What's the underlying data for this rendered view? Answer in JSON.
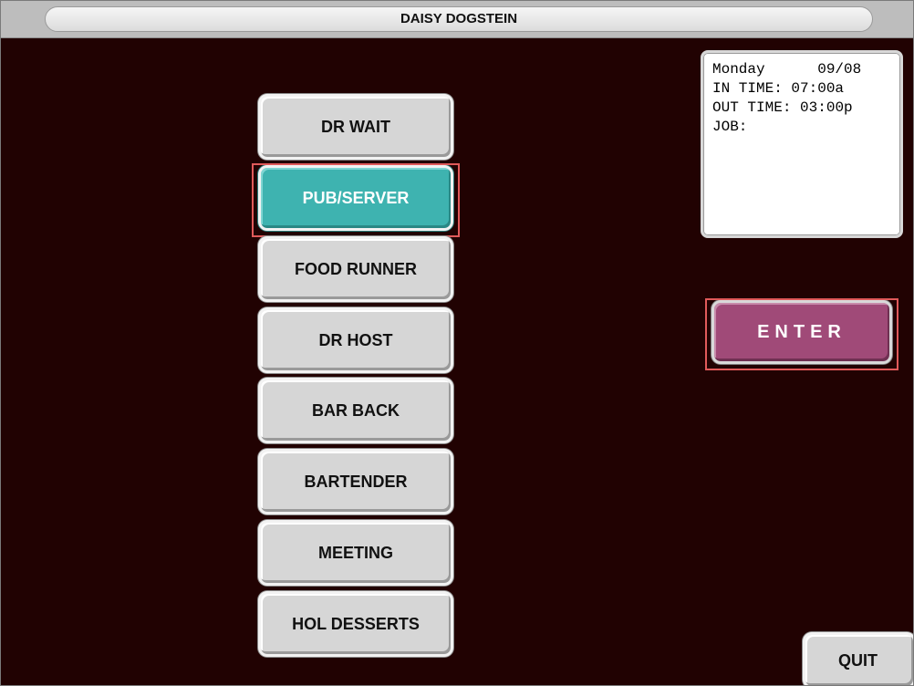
{
  "header": {
    "title": "DAISY DOGSTEIN"
  },
  "jobs": [
    {
      "label": "DR WAIT",
      "selected": false
    },
    {
      "label": "PUB/SERVER",
      "selected": true
    },
    {
      "label": "FOOD RUNNER",
      "selected": false
    },
    {
      "label": "DR HOST",
      "selected": false
    },
    {
      "label": "BAR BACK",
      "selected": false
    },
    {
      "label": "BARTENDER",
      "selected": false
    },
    {
      "label": "MEETING",
      "selected": false
    },
    {
      "label": "HOL DESSERTS",
      "selected": false
    }
  ],
  "info": {
    "day": "Monday",
    "date": "09/08",
    "in_label": "IN TIME:",
    "in_time": "07:00a",
    "out_label": "OUT TIME:",
    "out_time": "03:00p",
    "job_label": "JOB:",
    "job_value": ""
  },
  "actions": {
    "enter_label": "ENTER",
    "quit_label": "QUIT"
  },
  "colors": {
    "background": "#210202",
    "selected_job": "#3eb3b0",
    "enter_button": "#a04a78",
    "highlight_outline": "#e05a5a"
  }
}
